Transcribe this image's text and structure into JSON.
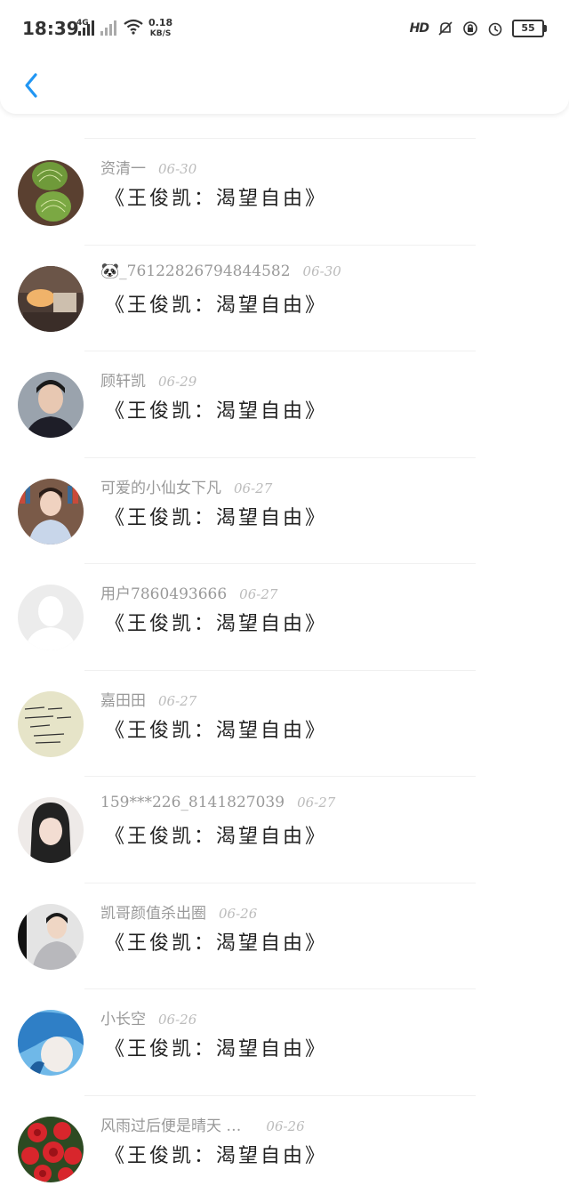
{
  "status": {
    "time": "18:39",
    "net_type": "4G",
    "speed_value": "0.18",
    "speed_unit": "KB/S",
    "hd": "HD",
    "battery": "55"
  },
  "header": {
    "back_icon": "chevron-left-icon"
  },
  "colors": {
    "accent": "#2196F3",
    "divider": "#f0f0f0"
  },
  "comments": [
    {
      "user": "资清一",
      "date": "06-30",
      "message": "《王俊凯：渴望自由》"
    },
    {
      "user": "🐼_7612282679484458​2",
      "date": "06-30",
      "message": "《王俊凯：渴望自由》"
    },
    {
      "user": "顾轩凯",
      "date": "06-29",
      "message": "《王俊凯：渴望自由》"
    },
    {
      "user": "可爱的小仙女下凡",
      "date": "06-27",
      "message": "《王俊凯：渴望自由》"
    },
    {
      "user": "用户7860493666",
      "date": "06-27",
      "message": "《王俊凯：渴望自由》"
    },
    {
      "user": "嘉田田",
      "date": "06-27",
      "message": "《王俊凯：渴望自由》"
    },
    {
      "user": "159***226_8141827039",
      "date": "06-27",
      "message": "《王俊凯：渴望自由》"
    },
    {
      "user": "凯哥颜值杀出圈",
      "date": "06-26",
      "message": "《王俊凯：渴望自由》"
    },
    {
      "user": "小长空",
      "date": "06-26",
      "message": "《王俊凯：渴望自由》"
    },
    {
      "user": "风雨过后便是晴天 …",
      "date": "06-26",
      "message": "《王俊凯：渴望自由》"
    }
  ]
}
